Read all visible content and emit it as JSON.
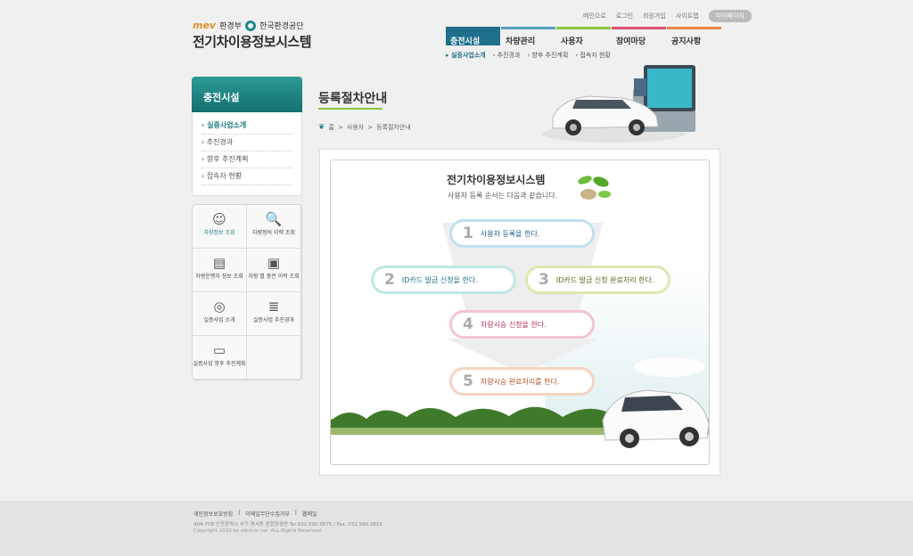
{
  "header": {
    "org_brand": "mev",
    "org_ministry": "환경부",
    "org_agency": "한국환경공단",
    "site_title": "전기차이용정보시스템",
    "util_links": [
      "메인으로",
      "로그인",
      "회원가입",
      "사이트맵"
    ],
    "mypage": "마이페이지"
  },
  "gnb": [
    {
      "label": "충전시설",
      "color": "#1f6f8b"
    },
    {
      "label": "차량관리",
      "color": "#5aa0c0"
    },
    {
      "label": "사용자",
      "color": "#8cc43c"
    },
    {
      "label": "참여마당",
      "color": "#d9536f"
    },
    {
      "label": "공지사항",
      "color": "#e8864a"
    }
  ],
  "lnb": [
    "실증사업소개",
    "추진경과",
    "향후 추진계획",
    "접속자 현황"
  ],
  "sidebar": {
    "title": "충전시설",
    "items": [
      "실증사업소개",
      "추진경과",
      "향후 추진계획",
      "접속자 현황"
    ]
  },
  "quick": [
    {
      "label": "차량정보 조회",
      "icon": "smile-icon"
    },
    {
      "label": "차량정비 이력 조회",
      "icon": "search-doc-icon"
    },
    {
      "label": "차량운행자 정보 조회",
      "icon": "folder-icon"
    },
    {
      "label": "차량 별 충전 이력 조회",
      "icon": "monitor-icon"
    },
    {
      "label": "실증사업 소개",
      "icon": "compass-icon"
    },
    {
      "label": "실증사업 추진경과",
      "icon": "stack-icon"
    },
    {
      "label": "실증사업 향후 추진계획",
      "icon": "computer-icon"
    }
  ],
  "content": {
    "page_title": "등록절차안내",
    "breadcrumb": [
      "홈",
      "사용자",
      "등록절차안내"
    ],
    "box_title": "전기차이용정보시스템",
    "box_subtitle": "사용자 등록 순서는 다음과 같습니다.",
    "steps": [
      {
        "num": "1",
        "text": "사용자 등록을 한다."
      },
      {
        "num": "2",
        "text": "ID카드 발급 신청을 한다."
      },
      {
        "num": "3",
        "text": "ID카드 발급 신청 완료처리 한다."
      },
      {
        "num": "4",
        "text": "차량시승 신청을 한다."
      },
      {
        "num": "5",
        "text": "차량시승 완료처리를 한다."
      }
    ]
  },
  "footer": {
    "links": [
      "개인정보보호방침",
      "이메일무단수집거부",
      "웹메일"
    ],
    "address": "404-708 인천광역시 서구 경서동 종합환경연 Tel.032.590.3875 / Fax. 032.590.3816",
    "copyright": "Copyright 2010 by electric car. ALL Rights Reserved."
  }
}
